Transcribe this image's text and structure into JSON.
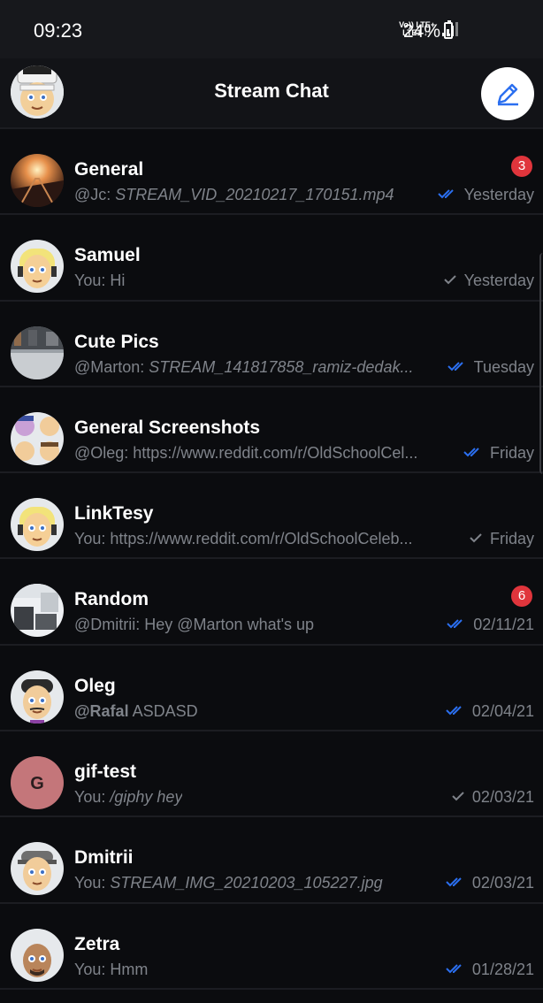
{
  "status_bar": {
    "time": "09:23",
    "net_line1": "Vo)) LTE+",
    "net_line2": "LTE1 ↓↑",
    "battery": "24%"
  },
  "header": {
    "title": "Stream Chat",
    "user_avatar_icon": "user-avatar-icon",
    "compose_icon": "pencil-icon"
  },
  "colors": {
    "accent_blue": "#2b6ff0",
    "badge_red": "#e0353c",
    "muted_text": "#7f838a"
  },
  "channels": [
    {
      "name": "General",
      "prefix": "@Jc: ",
      "text": "STREAM_VID_20210217_170151.mp4",
      "style": "att",
      "status": "read",
      "date": "Yesterday",
      "unread": "3",
      "avatar": "photo-sunset"
    },
    {
      "name": "Samuel",
      "prefix": "You: ",
      "text": "Hi",
      "style": "plain",
      "status": "sent",
      "date": "Yesterday",
      "unread": "",
      "avatar": "emoji-blonde"
    },
    {
      "name": "Cute Pics",
      "prefix": "@Marton: ",
      "text": "STREAM_141817858_ramiz-dedak...",
      "style": "att",
      "status": "read",
      "date": "Tuesday",
      "unread": "",
      "avatar": "photo-street"
    },
    {
      "name": "General Screenshots",
      "prefix": "@Oleg: ",
      "text": "https://www.reddit.com/r/OldSchoolCel...",
      "style": "plain",
      "status": "read",
      "date": "Friday",
      "unread": "",
      "avatar": "group-grid"
    },
    {
      "name": "LinkTesy",
      "prefix": "You: ",
      "text": "https://www.reddit.com/r/OldSchoolCeleb...",
      "style": "plain",
      "status": "sent",
      "date": "Friday",
      "unread": "",
      "avatar": "emoji-blonde"
    },
    {
      "name": "Random",
      "prefix": "@Dmitrii: ",
      "text": "Hey @Marton what's up",
      "style": "plain",
      "status": "read",
      "date": "02/11/21",
      "unread": "6",
      "avatar": "photo-room"
    },
    {
      "name": "Oleg",
      "prefix": "@Rafal",
      "text": " ASDASD",
      "style": "mention",
      "status": "read",
      "date": "02/04/21",
      "unread": "",
      "avatar": "emoji-dark"
    },
    {
      "name": "gif-test",
      "prefix": "You: ",
      "text": "/giphy hey",
      "style": "att",
      "status": "sent",
      "date": "02/03/21",
      "unread": "",
      "avatar": "letter-G",
      "letter": "G"
    },
    {
      "name": "Dmitrii",
      "prefix": "You: ",
      "text": "STREAM_IMG_20210203_105227.jpg",
      "style": "att",
      "status": "read",
      "date": "02/03/21",
      "unread": "",
      "avatar": "emoji-cap"
    },
    {
      "name": "Zetra",
      "prefix": "You: ",
      "text": "Hmm",
      "style": "plain",
      "status": "read",
      "date": "01/28/21",
      "unread": "",
      "avatar": "emoji-bald"
    }
  ]
}
